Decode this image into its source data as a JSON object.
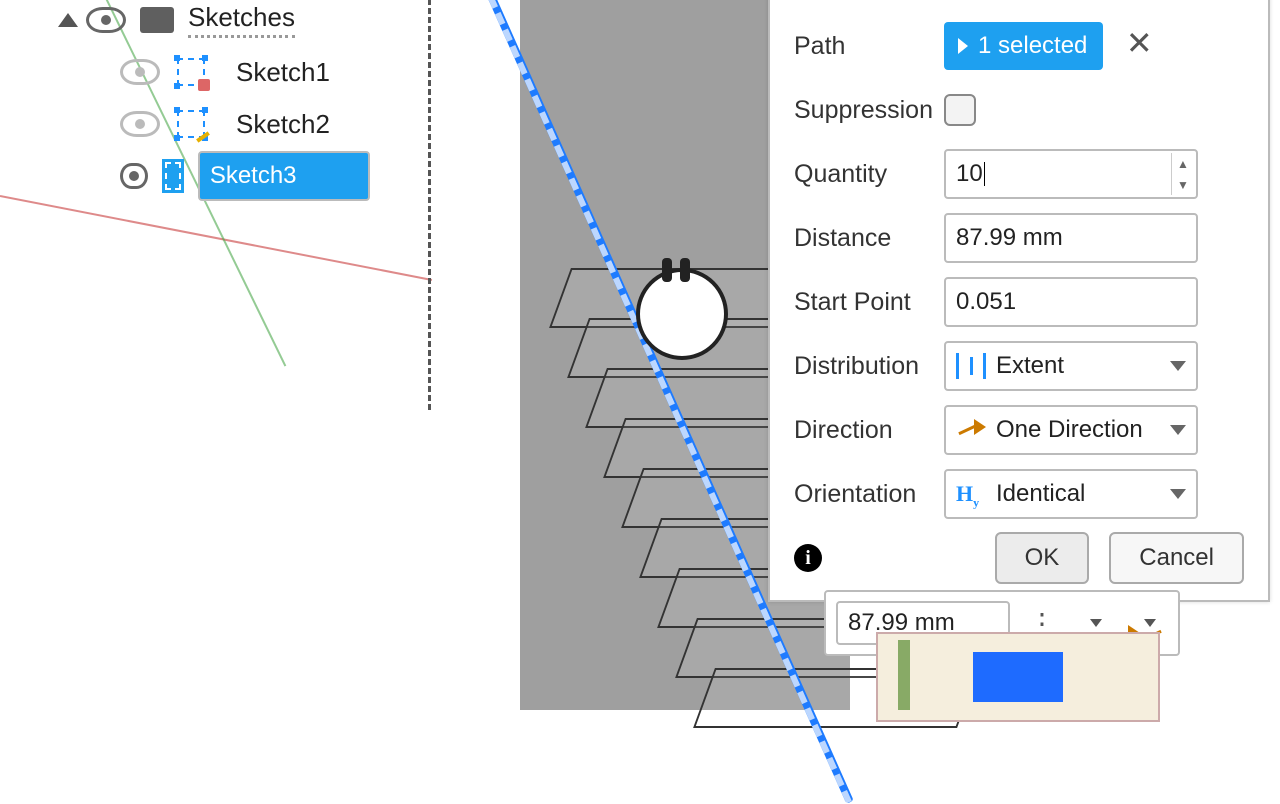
{
  "tree": {
    "header": "Sketches",
    "items": [
      {
        "label": "Sketch1",
        "visible": false,
        "locked": true,
        "selected": false
      },
      {
        "label": "Sketch2",
        "visible": false,
        "locked": false,
        "selected": false
      },
      {
        "label": "Sketch3",
        "visible": true,
        "locked": false,
        "selected": true
      }
    ]
  },
  "dialog": {
    "path": {
      "label": "Path",
      "chip": "1 selected"
    },
    "suppression": {
      "label": "Suppression",
      "checked": false
    },
    "quantity": {
      "label": "Quantity",
      "value": "10"
    },
    "distance": {
      "label": "Distance",
      "value": "87.99 mm"
    },
    "start": {
      "label": "Start Point",
      "value": "0.051"
    },
    "distribution": {
      "label": "Distribution",
      "value": "Extent"
    },
    "direction": {
      "label": "Direction",
      "value": "One Direction"
    },
    "orientation": {
      "label": "Orientation",
      "value": "Identical"
    },
    "ok": "OK",
    "cancel": "Cancel"
  },
  "floating": {
    "distance": "87.99 mm"
  }
}
